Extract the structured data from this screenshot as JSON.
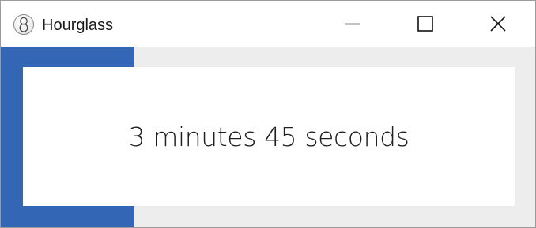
{
  "window": {
    "title": "Hourglass",
    "app_icon": "hourglass-8-icon",
    "controls": {
      "minimize_icon": "minimize-icon",
      "maximize_icon": "maximize-icon",
      "close_icon": "close-icon"
    }
  },
  "timer": {
    "display_text": "3 minutes 45 seconds",
    "progress_fraction": 0.25
  },
  "colors": {
    "progress": "#3366b5",
    "track": "#ededed",
    "panel": "#ffffff",
    "text": "#1f1f1f"
  }
}
